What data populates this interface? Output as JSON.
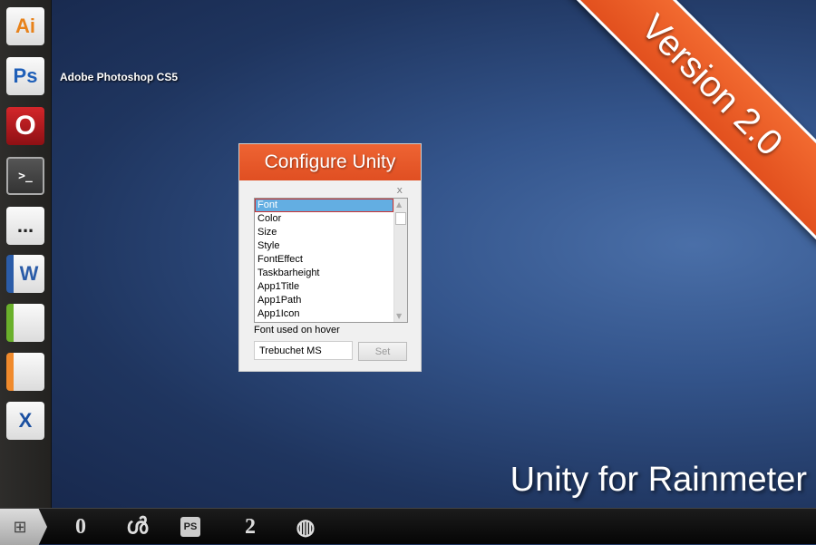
{
  "dock": {
    "apps": [
      {
        "name": "Adobe Illustrator",
        "label": "Ai",
        "color": "#e8821a"
      },
      {
        "name": "Adobe Photoshop CS5",
        "label": "Ps",
        "color": "#1f5fb8"
      },
      {
        "name": "Opera",
        "label": "O",
        "color": "#c0161b"
      },
      {
        "name": "Terminal",
        "label": ">_",
        "color": "#222222"
      },
      {
        "name": "Messaging",
        "label": "...",
        "color": "#222222"
      },
      {
        "name": "Word",
        "label": "W",
        "color": "#2b5ca8"
      },
      {
        "name": "Spreadsheet",
        "label": "",
        "color": "#6ab02b"
      },
      {
        "name": "Presentation",
        "label": "",
        "color": "#f08a2c"
      },
      {
        "name": "XChat",
        "label": "X",
        "color": "#1a4fa0"
      }
    ]
  },
  "hover_title": "Adobe Photoshop CS5",
  "ribbon": "Version 2.0",
  "brand": "Unity for Rainmeter",
  "dialog": {
    "title": "Configure Unity",
    "close": "x",
    "items": [
      "Font",
      "Color",
      "Size",
      "Style",
      "FontEffect",
      "Taskbarheight",
      "App1Title",
      "App1Path",
      "App1Icon"
    ],
    "selected": "Font",
    "description": "Font used on hover",
    "value": "Trebuchet MS",
    "set_label": "Set"
  },
  "taskbar": {
    "start": "start-icon",
    "items": [
      "0",
      "ൾ",
      "PS",
      "2",
      "◍"
    ]
  }
}
